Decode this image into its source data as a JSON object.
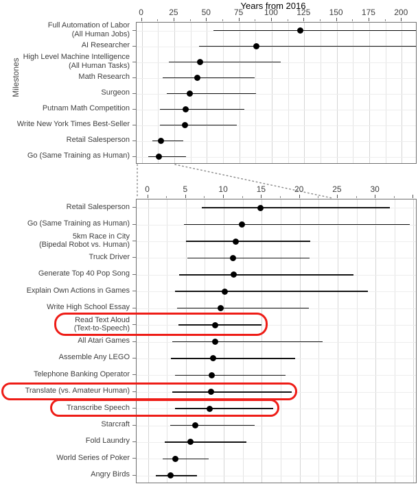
{
  "chart_data": [
    {
      "type": "scatter",
      "title": "Years from 2016",
      "xlabel": "Years from 2016",
      "ylabel": "Milestones",
      "xlim": [
        -4,
        212
      ],
      "xticks": [
        0,
        25,
        50,
        75,
        100,
        125,
        150,
        175,
        200
      ],
      "xtick_labels": [
        "0",
        "25",
        "50",
        "75",
        "100",
        "125",
        "150",
        "175",
        "200"
      ],
      "grid": true,
      "note": "dot = median estimate, horizontal line = uncertainty interval",
      "points": [
        {
          "label": "Full Automation of Labor\n(All Human Jobs)",
          "label_lines": [
            "Full Automation of Labor",
            "(All Human Jobs)"
          ],
          "value": 122,
          "low": 55,
          "high": 212,
          "high_clipped": true
        },
        {
          "label": "AI Researcher",
          "label_lines": [
            "AI Researcher"
          ],
          "value": 88,
          "low": 44,
          "high": 212,
          "high_clipped": true
        },
        {
          "label": "High Level Machine Intelligence\n(All Human Tasks)",
          "label_lines": [
            "High Level Machine Intelligence",
            "(All Human Tasks)"
          ],
          "value": 45,
          "low": 21,
          "high": 107,
          "high_clipped": false
        },
        {
          "label": "Math Research",
          "label_lines": [
            "Math Research"
          ],
          "value": 43,
          "low": 16,
          "high": 87,
          "high_clipped": false
        },
        {
          "label": "Surgeon",
          "label_lines": [
            "Surgeon"
          ],
          "value": 37,
          "low": 19,
          "high": 88,
          "high_clipped": false
        },
        {
          "label": "Putnam Math Competition",
          "label_lines": [
            "Putnam Math Competition"
          ],
          "value": 34,
          "low": 14,
          "high": 79,
          "high_clipped": false
        },
        {
          "label": "Write New York Times Best-Seller",
          "label_lines": [
            "Write New York Times Best-Seller"
          ],
          "value": 33,
          "low": 14,
          "high": 73,
          "high_clipped": false
        },
        {
          "label": "Retail Salesperson",
          "label_lines": [
            "Retail Salesperson"
          ],
          "value": 15,
          "low": 8,
          "high": 32,
          "high_clipped": false
        },
        {
          "label": "Go (Same Training as Human)",
          "label_lines": [
            "Go (Same Training as Human)"
          ],
          "value": 13,
          "low": 5,
          "high": 34,
          "high_clipped": false
        }
      ]
    },
    {
      "type": "scatter",
      "title": "",
      "xlabel": "Years from 2016",
      "ylabel": "Milestones",
      "xlim": [
        -1.5,
        35.5
      ],
      "xticks": [
        0,
        5,
        10,
        15,
        20,
        25,
        30
      ],
      "xtick_labels": [
        "0",
        "5",
        "10",
        "15",
        "20",
        "25",
        "30"
      ],
      "grid": true,
      "note": "zoomed-in view of 0 to ~34 years (inset of upper panel)",
      "points": [
        {
          "label": "Retail Salesperson",
          "label_lines": [
            "Retail Salesperson"
          ],
          "value": 14.8,
          "low": 7.1,
          "high": 31.9,
          "highlight": false
        },
        {
          "label": "Go (Same Training as Human)",
          "label_lines": [
            "Go (Same Training as Human)"
          ],
          "value": 12.4,
          "low": 4.7,
          "high": 34.5,
          "highlight": false
        },
        {
          "label": "5km Race in City\n(Bipedal Robot vs. Human)",
          "label_lines": [
            "5km Race in City",
            "(Bipedal Robot vs. Human)"
          ],
          "value": 11.6,
          "low": 5.0,
          "high": 21.4,
          "highlight": false
        },
        {
          "label": "Truck Driver",
          "label_lines": [
            "Truck Driver"
          ],
          "value": 11.2,
          "low": 5.2,
          "high": 21.3,
          "highlight": false
        },
        {
          "label": "Generate Top 40 Pop Song",
          "label_lines": [
            "Generate Top 40 Pop Song"
          ],
          "value": 11.3,
          "low": 4.1,
          "high": 27.1,
          "highlight": false
        },
        {
          "label": "Explain Own Actions in Games",
          "label_lines": [
            "Explain Own Actions in Games"
          ],
          "value": 10.1,
          "low": 3.6,
          "high": 29.0,
          "highlight": false
        },
        {
          "label": "Write High School Essay",
          "label_lines": [
            "Write High School Essay"
          ],
          "value": 9.6,
          "low": 3.8,
          "high": 21.2,
          "highlight": false
        },
        {
          "label": "Read Text Aloud\n(Text-to-Speech)",
          "label_lines": [
            "Read Text Aloud",
            "(Text-to-Speech)"
          ],
          "value": 8.9,
          "low": 4.0,
          "high": 15.0,
          "highlight": true
        },
        {
          "label": "All Atari Games",
          "label_lines": [
            "All Atari Games"
          ],
          "value": 8.9,
          "low": 3.2,
          "high": 23.0,
          "highlight": false
        },
        {
          "label": "Assemble Any LEGO",
          "label_lines": [
            "Assemble Any LEGO"
          ],
          "value": 8.6,
          "low": 3.0,
          "high": 19.4,
          "highlight": false
        },
        {
          "label": "Telephone Banking Operator",
          "label_lines": [
            "Telephone Banking Operator"
          ],
          "value": 8.4,
          "low": 3.6,
          "high": 18.1,
          "highlight": false
        },
        {
          "label": "Translate (vs. Amateur Human)",
          "label_lines": [
            "Translate (vs. Amateur Human)"
          ],
          "value": 8.3,
          "low": 3.2,
          "high": 18.9,
          "highlight": true
        },
        {
          "label": "Transcribe Speech",
          "label_lines": [
            "Transcribe Speech"
          ],
          "value": 8.1,
          "low": 3.6,
          "high": 16.5,
          "highlight": true
        },
        {
          "label": "Starcraft",
          "label_lines": [
            "Starcraft"
          ],
          "value": 6.2,
          "low": 2.9,
          "high": 14.1,
          "highlight": false
        },
        {
          "label": "Fold Laundry",
          "label_lines": [
            "Fold Laundry"
          ],
          "value": 5.6,
          "low": 2.2,
          "high": 13.0,
          "highlight": false
        },
        {
          "label": "World Series of Poker",
          "label_lines": [
            "World Series of Poker"
          ],
          "value": 3.6,
          "low": 1.9,
          "high": 8.0,
          "highlight": false
        },
        {
          "label": "Angry Birds",
          "label_lines": [
            "Angry Birds"
          ],
          "value": 3.0,
          "low": 1.0,
          "high": 6.5,
          "highlight": false
        }
      ]
    }
  ],
  "labels": {
    "axis_title": "Years from 2016",
    "y_axis_title": "Milestones"
  },
  "colors": {
    "highlight": "#ee1c16",
    "dot": "#000000",
    "grid": "#e3e3e3",
    "panel_border": "#6e6e6e",
    "text": "#3d3d3d"
  }
}
